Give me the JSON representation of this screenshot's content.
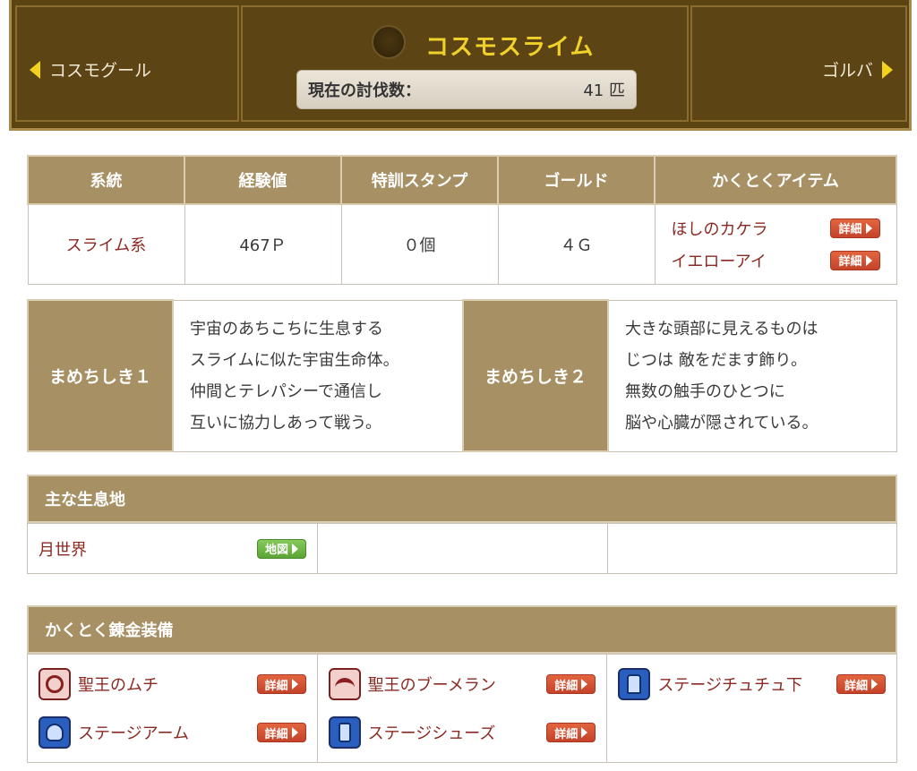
{
  "header": {
    "prev_label": "コスモグール",
    "next_label": "ゴルバ",
    "monster_name": "コスモスライム",
    "kill_count_label": "現在の討伐数：",
    "kill_count_value": "41 匹"
  },
  "stats": {
    "headers": [
      "系統",
      "経験値",
      "特訓スタンプ",
      "ゴールド",
      "かくとくアイテム"
    ],
    "family": "スライム系",
    "exp": "467Ｐ",
    "stamps": "０個",
    "gold": "４Ｇ",
    "items": [
      "ほしのカケラ",
      "イエローアイ"
    ],
    "detail_label": "詳細"
  },
  "trivia": [
    {
      "label": "まめちしき１",
      "lines": [
        "宇宙のあちこちに生息する",
        "スライムに似た宇宙生命体。",
        "仲間とテレパシーで通信し",
        "互いに協力しあって戦う。"
      ]
    },
    {
      "label": "まめちしき２",
      "lines": [
        "大きな頭部に見えるものは",
        "じつは 敵をだます飾り。",
        "無数の触手のひとつに",
        "脳や心臓が隠されている。"
      ]
    }
  ],
  "habitat": {
    "title": "主な生息地",
    "place": "月世界",
    "map_label": "地図"
  },
  "equipment": {
    "title": "かくとく錬金装備",
    "items": [
      {
        "name": "聖王のムチ",
        "icon": "whip-icon"
      },
      {
        "name": "聖王のブーメラン",
        "icon": "boomerang-icon"
      },
      {
        "name": "ステージチュチュ下",
        "icon": "leg-armor-icon"
      },
      {
        "name": "ステージアーム",
        "icon": "arm-armor-icon"
      },
      {
        "name": "ステージシューズ",
        "icon": "boots-icon"
      }
    ],
    "detail_label": "詳細"
  }
}
